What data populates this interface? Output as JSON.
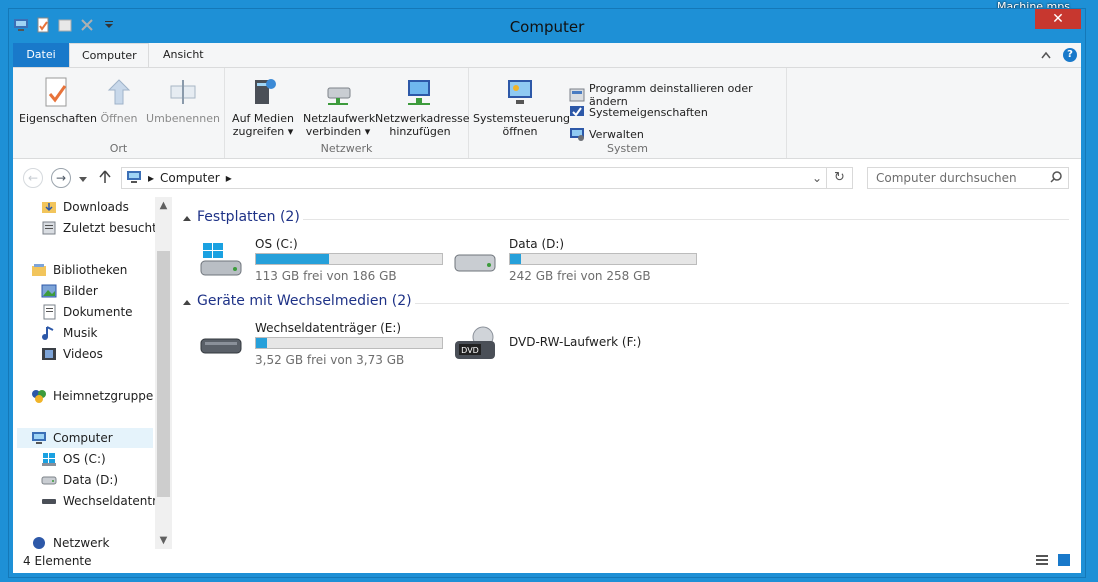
{
  "desktop": {
    "corner_label": "Machine.mps"
  },
  "window": {
    "title": "Computer",
    "close_label": "✕"
  },
  "tabs": {
    "file": "Datei",
    "computer": "Computer",
    "view": "Ansicht"
  },
  "ribbon": {
    "groups": {
      "ort": "Ort",
      "netzwerk": "Netzwerk",
      "system": "System"
    },
    "buttons": {
      "properties": "Eigenschaften",
      "open": "Öffnen",
      "rename": "Umbenennen",
      "media_line1": "Auf Medien",
      "media_line2": "zugreifen",
      "netdrive_line1": "Netzlaufwerk",
      "netdrive_line2": "verbinden",
      "netaddr_line1": "Netzwerkadresse",
      "netaddr_line2": "hinzufügen",
      "cpanel_line1": "Systemsteuerung",
      "cpanel_line2": "öffnen",
      "uninstall": "Programm deinstallieren oder ändern",
      "sysprops": "Systemeigenschaften",
      "manage": "Verwalten"
    }
  },
  "address": {
    "path": "Computer",
    "search_placeholder": "Computer durchsuchen"
  },
  "navpane": {
    "items": [
      {
        "label": "Downloads"
      },
      {
        "label": "Zuletzt besucht"
      },
      {
        "label": "Bibliotheken"
      },
      {
        "label": "Bilder"
      },
      {
        "label": "Dokumente"
      },
      {
        "label": "Musik"
      },
      {
        "label": "Videos"
      },
      {
        "label": "Heimnetzgruppe"
      },
      {
        "label": "Computer"
      },
      {
        "label": "OS (C:)"
      },
      {
        "label": "Data (D:)"
      },
      {
        "label": "Wechseldatenträ"
      },
      {
        "label": "Netzwerk"
      }
    ]
  },
  "main": {
    "harddisks_header": "Festplatten (2)",
    "removable_header": "Geräte mit Wechselmedien (2)",
    "drives": [
      {
        "name": "OS (C:)",
        "free": "113 GB frei von 186 GB",
        "used_fraction": 0.39
      },
      {
        "name": "Data (D:)",
        "free": "242 GB frei von 258 GB",
        "used_fraction": 0.06
      },
      {
        "name": "Wechseldatenträger (E:)",
        "free": "3,52 GB frei von 3,73 GB",
        "used_fraction": 0.06
      },
      {
        "name": "DVD-RW-Laufwerk (F:)"
      }
    ]
  },
  "status": {
    "count": "4 Elemente"
  },
  "colors": {
    "accent": "#1979ca",
    "bar_fill": "#26a0da",
    "section_text": "#1e3287",
    "window_frame": "#1e90d6"
  }
}
